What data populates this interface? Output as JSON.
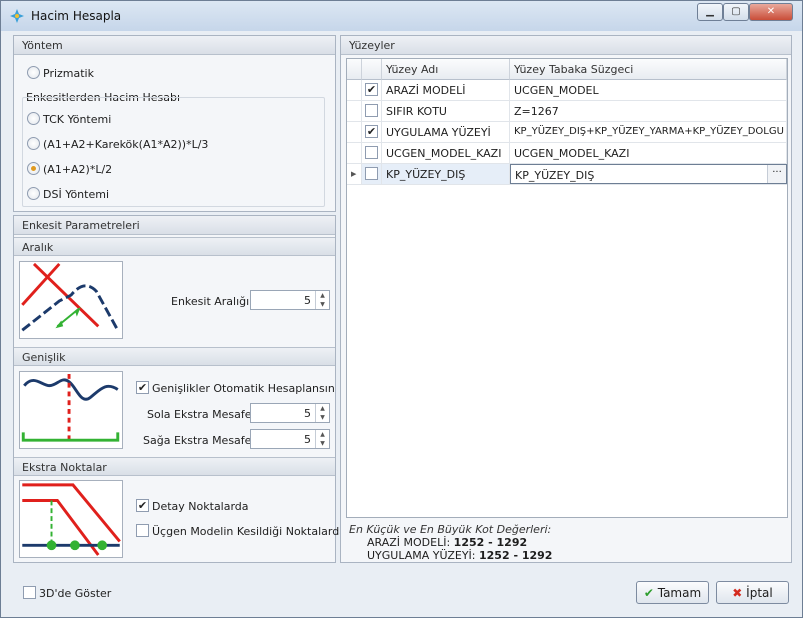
{
  "window": {
    "title": "Hacim Hesapla"
  },
  "yontem": {
    "header": "Yöntem",
    "prizmatik": "Prizmatik",
    "group_title": "Enkesitlerden Hacim Hesabı",
    "options": [
      {
        "label": "TCK Yöntemi",
        "checked": false
      },
      {
        "label": "(A1+A2+Karekök(A1*A2))*L/3",
        "checked": false
      },
      {
        "label": "(A1+A2)*L/2",
        "checked": true
      },
      {
        "label": "DSİ Yöntemi",
        "checked": false
      }
    ]
  },
  "enkesit": {
    "header": "Enkesit Parametreleri",
    "aralik": {
      "header": "Aralık",
      "label": "Enkesit Aralığı:",
      "value": "5"
    },
    "genislik": {
      "header": "Genişlik",
      "auto_label": "Genişlikler Otomatik Hesaplansın",
      "auto_checked": true,
      "sola_label": "Sola Ekstra Mesafe:",
      "sola_value": "5",
      "saga_label": "Sağa Ekstra Mesafe:",
      "saga_value": "5"
    },
    "ekstra": {
      "header": "Ekstra Noktalar",
      "detay_label": "Detay Noktalarda",
      "detay_checked": true,
      "ucgen_label": "Üçgen Modelin Kesildiği Noktalarda",
      "ucgen_checked": false
    }
  },
  "yuzeyler": {
    "header": "Yüzeyler",
    "columns": [
      "Yüzey Adı",
      "Yüzey Tabaka Süzgeci"
    ],
    "rows": [
      {
        "name": "ARAZİ MODELİ",
        "filter": "UCGEN_MODEL",
        "checked": true
      },
      {
        "name": "SIFIR KOTU",
        "filter": "Z=1267",
        "checked": false
      },
      {
        "name": "UYGULAMA YÜZEYİ",
        "filter": "KP_YÜZEY_DIŞ+KP_YÜZEY_YARMA+KP_YÜZEY_DOLGU",
        "checked": true
      },
      {
        "name": "UCGEN_MODEL_KAZI",
        "filter": "UCGEN_MODEL_KAZI",
        "checked": false
      },
      {
        "name": "KP_YÜZEY_DIŞ",
        "filter": "KP_YÜZEY_DIŞ",
        "checked": false
      }
    ],
    "ellipsis": "···"
  },
  "info": {
    "title": "En Küçük ve En Büyük Kot Değerleri:",
    "lines": [
      {
        "label": "ARAZİ MODELİ: ",
        "value": "1252 - 1292"
      },
      {
        "label": "UYGULAMA YÜZEYİ: ",
        "value": "1252 - 1292"
      }
    ]
  },
  "footer": {
    "show3d_label": "3D'de Göster",
    "ok_label": "Tamam",
    "cancel_label": "İptal"
  },
  "colors": {
    "accent_red": "#e0201c",
    "accent_navy": "#1c3a6b",
    "accent_green": "#33b233",
    "radio_selected": "#e09a20"
  }
}
